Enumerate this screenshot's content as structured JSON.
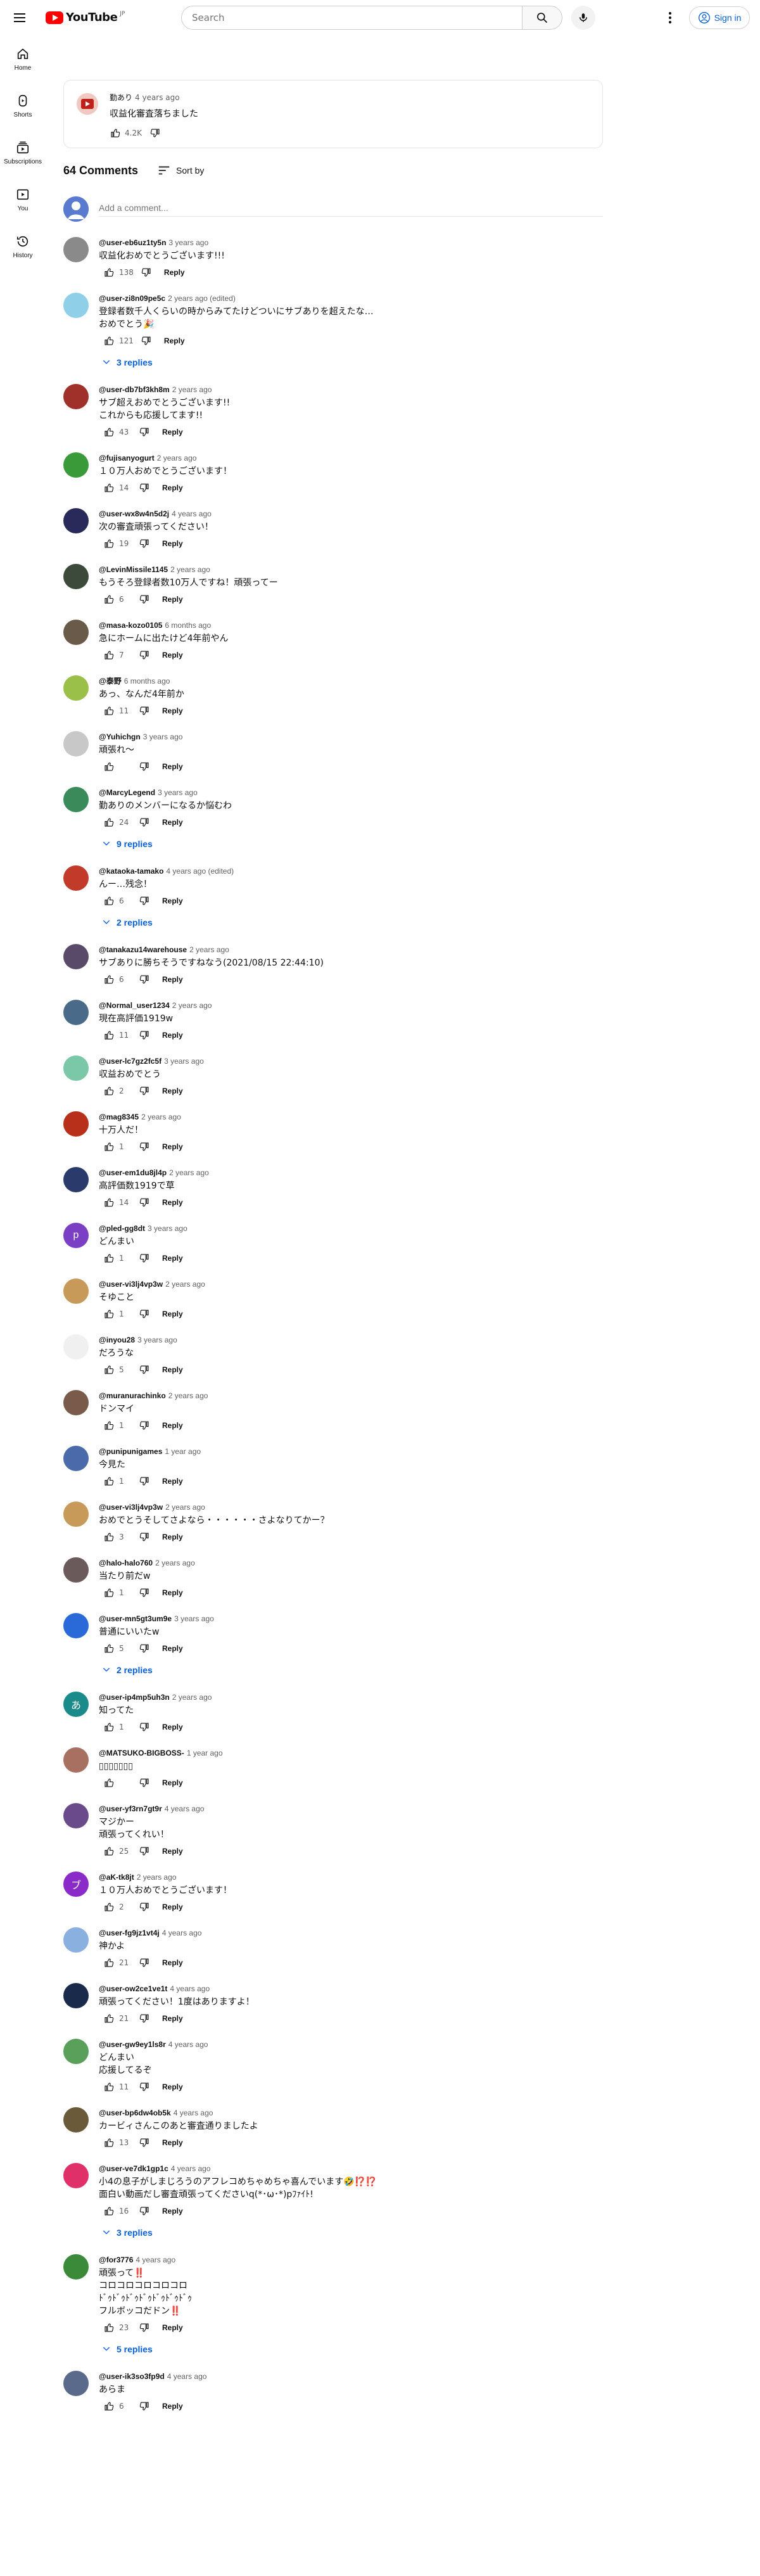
{
  "header": {
    "logo_text": "YouTube",
    "logo_country": "JP",
    "search_placeholder": "Search",
    "sign_in": "Sign in"
  },
  "sidebar": [
    {
      "label": "Home",
      "icon": "home-icon"
    },
    {
      "label": "Shorts",
      "icon": "shorts-icon"
    },
    {
      "label": "Subscriptions",
      "icon": "subscriptions-icon"
    },
    {
      "label": "You",
      "icon": "you-icon"
    },
    {
      "label": "History",
      "icon": "history-icon"
    }
  ],
  "post": {
    "author": "勤あり",
    "time": "4 years ago",
    "text": "収益化審査落ちました",
    "likes": "4.2K"
  },
  "comments_header": {
    "count": "64 Comments",
    "sort_label": "Sort by"
  },
  "add_comment_placeholder": "Add a comment...",
  "comments": [
    {
      "author": "@user-eb6uz1ty5n",
      "time": "3 years ago",
      "text": "収益化おめでとうございます!!!",
      "likes": "138",
      "color": "#8a8a8a"
    },
    {
      "author": "@user-zi8n09pe5c",
      "time": "2 years ago (edited)",
      "text": "登録者数千人くらいの時からみてたけどついにサブありを超えたな…\nおめでとう🎉",
      "likes": "121",
      "replies": "3 replies",
      "color": "#8fd0e8"
    },
    {
      "author": "@user-db7bf3kh8m",
      "time": "2 years ago",
      "text": "サブ超えおめでとうございます!!\nこれからも応援してます!!",
      "likes": "43",
      "color": "#a0302a"
    },
    {
      "author": "@fujisanyogurt",
      "time": "2 years ago",
      "text": "１０万人おめでとうございます！",
      "likes": "14",
      "color": "#3a9a3a"
    },
    {
      "author": "@user-wx8w4n5d2j",
      "time": "4 years ago",
      "text": "次の審査頑張ってください！",
      "likes": "19",
      "color": "#2a2a5a"
    },
    {
      "author": "@LevinMissile1145",
      "time": "2 years ago",
      "text": "もうそろ登録者数10万人ですね！頑張ってー",
      "likes": "6",
      "color": "#3c4a3c"
    },
    {
      "author": "@masa-kozo0105",
      "time": "6 months ago",
      "text": "急にホームに出たけど4年前やん",
      "likes": "7",
      "color": "#6a5a4a"
    },
    {
      "author": "@泰野",
      "time": "6 months ago",
      "text": "あっ、なんだ4年前か",
      "likes": "11",
      "color": "#9ac04a"
    },
    {
      "author": "@Yuhichgn",
      "time": "3 years ago",
      "text": "頑張れ〜",
      "likes": "",
      "color": "#c8c8c8"
    },
    {
      "author": "@MarcyLegend",
      "time": "3 years ago",
      "text": "勤ありのメンバーになるか悩むわ",
      "likes": "24",
      "replies": "9 replies",
      "color": "#3a8a5a"
    },
    {
      "author": "@kataoka-tamako",
      "time": "4 years ago (edited)",
      "text": "んー…残念！",
      "likes": "6",
      "replies": "2 replies",
      "color": "#c23a2a"
    },
    {
      "author": "@tanakazu14warehouse",
      "time": "2 years ago",
      "text": "サブありに勝ちそうですねなう(2021/08/15 22:44:10)",
      "likes": "6",
      "color": "#5a4a6a"
    },
    {
      "author": "@Normal_user1234",
      "time": "2 years ago",
      "text": "現在高評価1919w",
      "likes": "11",
      "color": "#4a6a8a"
    },
    {
      "author": "@user-lc7gz2fc5f",
      "time": "3 years ago",
      "text": "収益おめでとう",
      "likes": "2",
      "color": "#7ac8a8"
    },
    {
      "author": "@mag8345",
      "time": "2 years ago",
      "text": "十万人だ！",
      "likes": "1",
      "color": "#b8301a"
    },
    {
      "author": "@user-em1du8jl4p",
      "time": "2 years ago",
      "text": "高評価数1919で草",
      "likes": "14",
      "color": "#2a3a6a"
    },
    {
      "author": "@pled-gg8dt",
      "time": "3 years ago",
      "text": "どんまい",
      "likes": "1",
      "color": "#7b3fc4",
      "initial": "p"
    },
    {
      "author": "@user-vi3lj4vp3w",
      "time": "2 years ago",
      "text": "そゆこと",
      "likes": "1",
      "color": "#c89a5a"
    },
    {
      "author": "@inyou28",
      "time": "3 years ago",
      "text": "だろうな",
      "likes": "5",
      "color": "#f0f0f0"
    },
    {
      "author": "@muranurachinko",
      "time": "2 years ago",
      "text": "ドンマイ",
      "likes": "1",
      "color": "#7a5a4a"
    },
    {
      "author": "@punipunigames",
      "time": "1 year ago",
      "text": "今見た",
      "likes": "1",
      "color": "#4a6aaa"
    },
    {
      "author": "@user-vi3lj4vp3w",
      "time": "2 years ago",
      "text": "おめでとうそしてさよなら・・・・・・さよなりてかー？",
      "likes": "3",
      "color": "#c89a5a"
    },
    {
      "author": "@halo-halo760",
      "time": "2 years ago",
      "text": "当たり前だw",
      "likes": "1",
      "color": "#6a5a5a"
    },
    {
      "author": "@user-mn5gt3um9e",
      "time": "3 years ago",
      "text": "普通にいいたw",
      "likes": "5",
      "replies": "2 replies",
      "color": "#2a6ad8"
    },
    {
      "author": "@user-ip4mp5uh3n",
      "time": "2 years ago",
      "text": "知ってた",
      "likes": "1",
      "color": "#1a8a8a",
      "initial": "あ"
    },
    {
      "author": "@MATSUKO-BIGBOSS-",
      "time": "1 year ago",
      "text": "▯▯▯▯▯▯▯",
      "likes": "",
      "color": "#a87060"
    },
    {
      "author": "@user-yf3rn7gt9r",
      "time": "4 years ago",
      "text": "マジかー\n頑張ってくれい！",
      "likes": "25",
      "color": "#6a4a8a"
    },
    {
      "author": "@aK-tk8jt",
      "time": "2 years ago",
      "text": "１０万人おめでとうございます！",
      "likes": "2",
      "color": "#8a2ac8",
      "initial": "ブ"
    },
    {
      "author": "@user-fg9jz1vt4j",
      "time": "4 years ago",
      "text": "神かよ",
      "likes": "21",
      "color": "#8ab0e0"
    },
    {
      "author": "@user-ow2ce1ve1t",
      "time": "4 years ago",
      "text": "頑張ってください！1度はありますよ！",
      "likes": "21",
      "color": "#1a2a4a"
    },
    {
      "author": "@user-gw9ey1ls8r",
      "time": "4 years ago",
      "text": "どんまい\n応援してるぞ",
      "likes": "11",
      "color": "#5aa05a"
    },
    {
      "author": "@user-bp6dw4ob5k",
      "time": "4 years ago",
      "text": "カービィさんこのあと審査通りましたよ",
      "likes": "13",
      "color": "#6a5a3a"
    },
    {
      "author": "@user-ve7dk1gp1c",
      "time": "4 years ago",
      "text": "小4の息子がしまじろうのアフレコめちゃめちゃ喜んでいます🤣⁉️⁉️\n面白い動画だし審査頑張ってくださいq(*･ω･*)pﾌｧｲﾄ!",
      "likes": "16",
      "replies": "3 replies",
      "color": "#e0306a"
    },
    {
      "author": "@for3776",
      "time": "4 years ago",
      "text": "頑張って‼️\nコロコロコロコロコロ\nﾄﾞｩﾄﾞｩﾄﾞｩﾄﾞｩﾄﾞｩﾄﾞｩﾄﾞｩ\nフルボッコだドン‼️",
      "likes": "23",
      "replies": "5 replies",
      "color": "#3a8a3a"
    },
    {
      "author": "@user-ik3so3fp9d",
      "time": "4 years ago",
      "text": "あらま",
      "likes": "6",
      "color": "#5a6a8a"
    }
  ]
}
